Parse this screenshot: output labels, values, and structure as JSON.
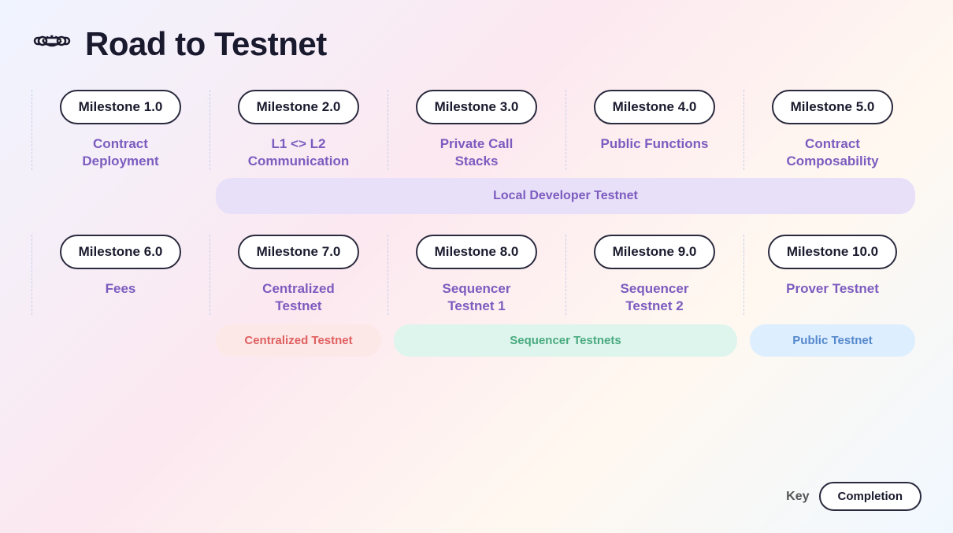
{
  "header": {
    "title": "Road to Testnet"
  },
  "top_milestones": [
    {
      "badge": "Milestone 1.0",
      "label": "Contract\nDeployment",
      "color": "#7c5cbf"
    },
    {
      "badge": "Milestone 2.0",
      "label": "L1 <> L2\nCommunication",
      "color": "#7c5cbf"
    },
    {
      "badge": "Milestone 3.0",
      "label": "Private Call\nStacks",
      "color": "#7c5cbf"
    },
    {
      "badge": "Milestone 4.0",
      "label": "Public Functions",
      "color": "#7c5cbf"
    },
    {
      "badge": "Milestone 5.0",
      "label": "Contract\nComposability",
      "color": "#7c5cbf"
    }
  ],
  "banner": {
    "text": "Local Developer Testnet",
    "color": "#7c5cbf",
    "bg": "#e8e0f8"
  },
  "bottom_milestones": [
    {
      "badge": "Milestone 6.0",
      "label": "Fees",
      "color": "#7c5cbf"
    },
    {
      "badge": "Milestone 7.0",
      "label": "Centralized\nTestnet",
      "color": "#7c5cbf"
    },
    {
      "badge": "Milestone 8.0",
      "label": "Sequencer\nTestnet 1",
      "color": "#7c5cbf"
    },
    {
      "badge": "Milestone 9.0",
      "label": "Sequencer\nTestnet 2",
      "color": "#7c5cbf"
    },
    {
      "badge": "Milestone 10.0",
      "label": "Prover Testnet",
      "color": "#7c5cbf"
    }
  ],
  "sub_banners": [
    {
      "col": 2,
      "text": "Centralized Testnet",
      "style": "pink",
      "span": 1
    },
    {
      "col": 3,
      "text": "Sequencer Testnets",
      "style": "green",
      "span": 2
    },
    {
      "col": 5,
      "text": "Public Testnet",
      "style": "blue",
      "span": 1
    }
  ],
  "key": {
    "label": "Key",
    "badge": "Completion"
  }
}
